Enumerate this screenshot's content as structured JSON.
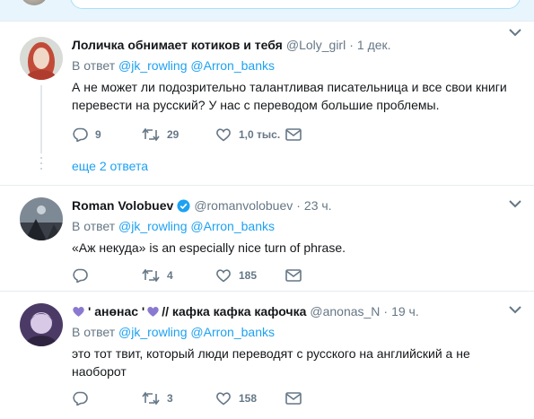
{
  "tweets": [
    {
      "name": "Лоличка обнимает котиков и тебя",
      "handle": "@Loly_girl",
      "dot": "·",
      "time": "1 дек.",
      "replying_prefix": "В ответ",
      "mentions": [
        "@jk_rowling",
        "@Arron_banks"
      ],
      "text": "А не может ли подозрительно талантливая писательница и все свои книги перевести на русский? У нас с переводом большие проблемы.",
      "replies": "9",
      "retweets": "29",
      "likes": "1,0 тыс.",
      "more_replies": "еще 2 ответа"
    },
    {
      "name": "Roman Volobuev",
      "handle": "@romanvolobuev",
      "dot": "·",
      "time": "23 ч.",
      "replying_prefix": "В ответ",
      "mentions": [
        "@jk_rowling",
        "@Arron_banks"
      ],
      "text": "«Аж некуда» is an especially nice turn of phrase.",
      "replies": "",
      "retweets": "4",
      "likes": "185"
    },
    {
      "name_parts": [
        "' анɵнас '",
        "// кафка кафка кафочка"
      ],
      "handle": "@anonas_N",
      "dot": "·",
      "time": "19 ч.",
      "replying_prefix": "В ответ",
      "mentions": [
        "@jk_rowling",
        "@Arron_banks"
      ],
      "text": "это тот твит, который люди переводят с русского на английский а не наоборот",
      "replies": "",
      "retweets": "3",
      "likes": "158"
    }
  ],
  "colors": {
    "link": "#1da1f2",
    "muted": "#657786",
    "heart": "#8b79d1"
  },
  "icons": [
    "reply-icon",
    "retweet-icon",
    "like-icon",
    "direct-message-icon",
    "caret-down-icon",
    "verified-badge-icon",
    "purple-heart-icon"
  ]
}
